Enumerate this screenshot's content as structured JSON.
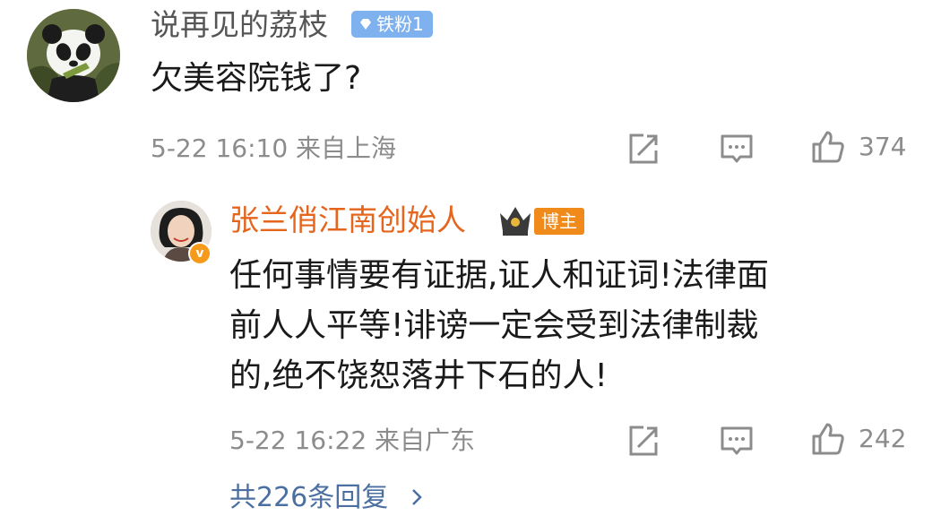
{
  "comment": {
    "username": "说再见的荔枝",
    "fan_badge": "铁粉1",
    "text": "欠美容院钱了?",
    "meta": "5-22 16:10 来自上海",
    "like_count": "374"
  },
  "reply": {
    "username": "张兰俏江南创始人",
    "host_badge": "博主",
    "text_lines": [
      "任何事情要有证据,证人和证词!法律面",
      "前人人平等!诽谤一定会受到法律制裁",
      "的,绝不饶恕落井下石的人!"
    ],
    "meta": "5-22 16:22 来自广东",
    "like_count": "242"
  },
  "more_replies": "共226条回复",
  "icons": [
    "panda-avatar",
    "diamond-icon",
    "share-icon",
    "comment-icon",
    "like-icon",
    "crown-icon",
    "verified-icon",
    "chevron-right-icon"
  ]
}
